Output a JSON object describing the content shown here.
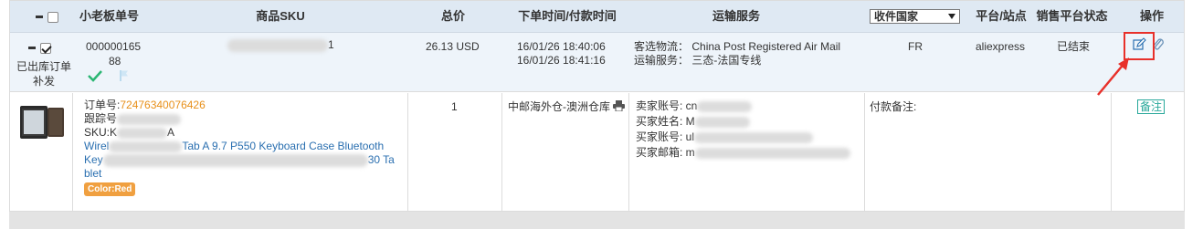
{
  "header": {
    "select_all_label": "",
    "col_order_no": "小老板单号",
    "col_sku": "商品SKU",
    "col_total": "总价",
    "col_time": "下单时间/付款时间",
    "col_shipping": "运输服务",
    "col_country_select": "收件国家",
    "col_platform": "平台/站点",
    "col_sales_status": "销售平台状态",
    "col_action": "操作"
  },
  "order": {
    "status_label_line1": "已出库订单",
    "status_label_line2": "补发",
    "order_no": "000000165",
    "sub_no": "88",
    "sku_tail": "1",
    "total": "26.13 USD",
    "order_time": "16/01/26 18:40:06",
    "pay_time": "16/01/26 18:41:16",
    "shipping_logistics_label": "客选物流：",
    "shipping_logistics_value": "China Post Registered Air Mail",
    "shipping_service_label": "运输服务：",
    "shipping_service_value": "三态-法国专线",
    "country": "FR",
    "platform": "aliexpress",
    "sales_status": "已结束"
  },
  "item": {
    "order_no_label": "订单号:",
    "order_no_value": "72476340076426",
    "tracking_label": "跟踪号",
    "sku_label": "SKU:K",
    "sku_tail": "A",
    "title_line1_start": "Wirel",
    "title_line1_end": "Tab A 9.7 P550 Keyboard Case Bluetooth",
    "title_line2_start": "Key",
    "title_line2_end": "30 Ta",
    "title_line3": "blet",
    "variant_tag": "Color:Red",
    "quantity": "1",
    "warehouse": "中邮海外仓-澳洲仓库",
    "seller_account_label": "卖家账号: cn",
    "buyer_name_label": "买家姓名: M",
    "buyer_account_label": "买家账号: ul",
    "buyer_email_label": "买家邮箱: m",
    "payment_note_label": "付款备注:",
    "note_button": "备注"
  },
  "colors": {
    "header_bg": "#dfe9f3",
    "row_bg": "#eef4fa",
    "link": "#2a6fb0",
    "order_no": "#e8901a",
    "accent_green": "#2bb673",
    "annotation_red": "#e8302a"
  }
}
